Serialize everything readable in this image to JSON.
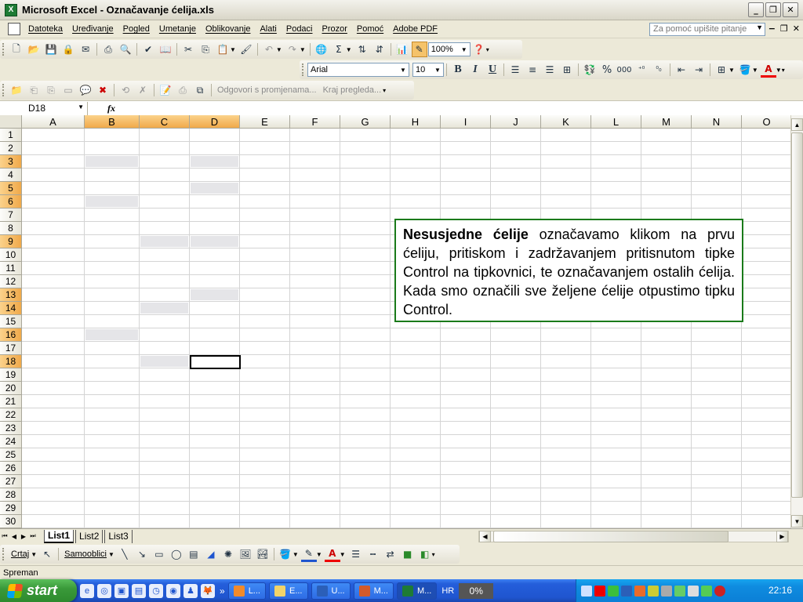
{
  "window": {
    "title": "Microsoft Excel - Označavanje ćelija.xls"
  },
  "menu": {
    "items": [
      "Datoteka",
      "Uređivanje",
      "Pogled",
      "Umetanje",
      "Oblikovanje",
      "Alati",
      "Podaci",
      "Prozor",
      "Pomoć",
      "Adobe PDF"
    ],
    "help_placeholder": "Za pomoć upišite pitanje"
  },
  "standard_toolbar": {
    "zoom": "100%"
  },
  "format_toolbar": {
    "font": "Arial",
    "size": "10",
    "bold": "B",
    "italic": "I",
    "underline": "U",
    "percent": "%",
    "thousands": "000"
  },
  "review_toolbar": {
    "reply": "Odgovori s promjenama...",
    "end_review": "Kraj pregleda..."
  },
  "formula_bar": {
    "name_box": "D18",
    "fx": "fx",
    "content": ""
  },
  "grid": {
    "columns": [
      "A",
      "B",
      "C",
      "D",
      "E",
      "F",
      "G",
      "H",
      "I",
      "J",
      "K",
      "L",
      "M",
      "N",
      "O"
    ],
    "selected_columns": [
      "B",
      "C",
      "D"
    ],
    "rows": [
      "1",
      "2",
      "3",
      "4",
      "5",
      "6",
      "7",
      "8",
      "9",
      "10",
      "11",
      "12",
      "13",
      "14",
      "15",
      "16",
      "17",
      "18",
      "19",
      "20",
      "21",
      "22",
      "23",
      "24",
      "25",
      "26",
      "27",
      "28",
      "29",
      "30"
    ],
    "selected_rows": [
      "3",
      "5",
      "6",
      "9",
      "13",
      "14",
      "16",
      "18"
    ],
    "active_cell": "D18"
  },
  "info_box": {
    "bold_lead": "Nesusjedne ćelije",
    "text": " označavamo klikom na prvu ćeliju, pritiskom i zadržavanjem pritisnutom tipke Control na tipkovnici, te označavanjem ostalih ćelija. Kada smo označili sve željene ćelije otpustimo tipku Control."
  },
  "sheets": {
    "tabs": [
      "List1",
      "List2",
      "List3"
    ],
    "active": "List1"
  },
  "drawing_toolbar": {
    "draw": "Crtaj",
    "autoshapes": "Samooblici"
  },
  "status": {
    "text": "Spreman"
  },
  "taskbar": {
    "start": "start",
    "items": [
      "L...",
      "E...",
      "U...",
      "M...",
      "M..."
    ],
    "lang": "HR",
    "percent": "0%",
    "clock": "22:16"
  }
}
